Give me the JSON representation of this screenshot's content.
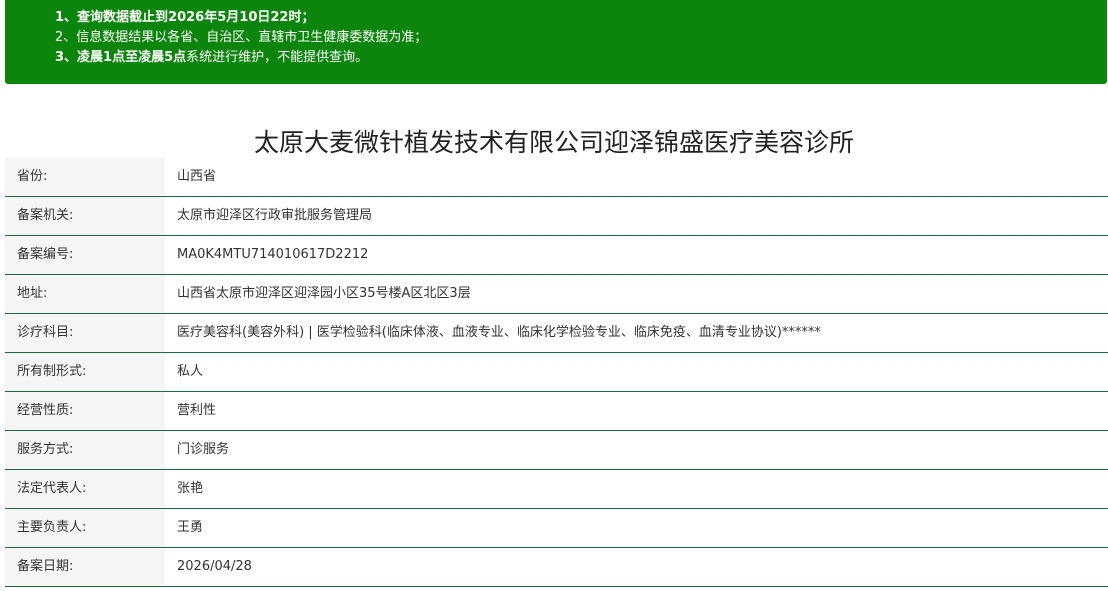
{
  "notice": {
    "line1_prefix": "1、查询数据截止到",
    "line1_bold": "2026年5月10日22时",
    "line1_suffix": "；",
    "line2": "2、信息数据结果以各省、自治区、直辖市卫生健康委数据为准；",
    "line3_prefix": "3、",
    "line3_bold": "凌晨1点至凌晨5点",
    "line3_suffix": "系统进行维护，不能提供查询。"
  },
  "title": "太原大麦微针植发技术有限公司迎泽锦盛医疗美容诊所",
  "rows": [
    {
      "label": "省份:",
      "value": "山西省"
    },
    {
      "label": "备案机关:",
      "value": "太原市迎泽区行政审批服务管理局"
    },
    {
      "label": "备案编号:",
      "value": "MA0K4MTU714010617D2212"
    },
    {
      "label": "地址:",
      "value": "山西省太原市迎泽区迎泽园小区35号楼A区北区3层"
    },
    {
      "label": "诊疗科目:",
      "value": "医疗美容科(美容外科) | 医学检验科(临床体液、血液专业、临床化学检验专业、临床免疫、血清专业协议)******"
    },
    {
      "label": "所有制形式:",
      "value": "私人"
    },
    {
      "label": "经营性质:",
      "value": "营利性"
    },
    {
      "label": "服务方式:",
      "value": "门诊服务"
    },
    {
      "label": "法定代表人:",
      "value": "张艳"
    },
    {
      "label": "主要负责人:",
      "value": "王勇"
    },
    {
      "label": "备案日期:",
      "value": "2026/04/28"
    }
  ],
  "colors": {
    "notice_bg": "#0c850c",
    "row_border": "#1a6b3c",
    "label_bg": "#f5f5f5"
  }
}
